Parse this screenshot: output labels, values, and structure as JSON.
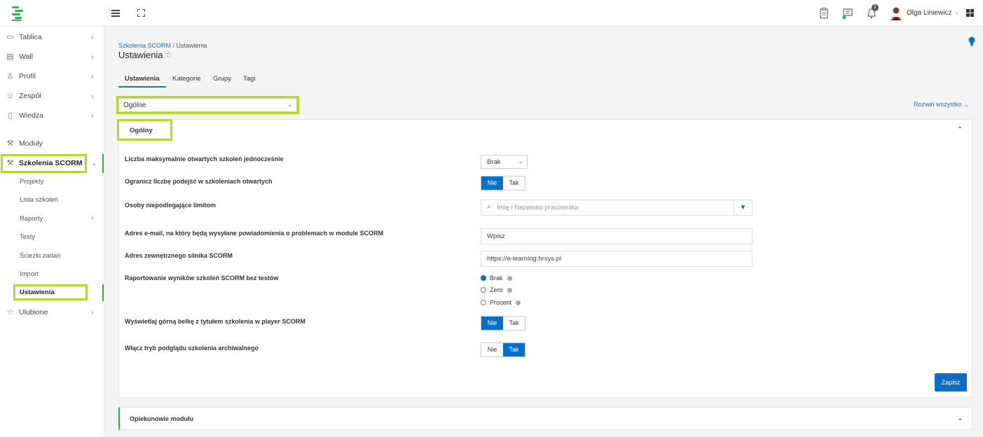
{
  "topbar": {
    "username": "Olga Liniewicz",
    "notification_count": "1"
  },
  "sidebar": {
    "items": [
      {
        "label": "Tablica"
      },
      {
        "label": "Wall"
      },
      {
        "label": "Profil"
      },
      {
        "label": "Zespół"
      },
      {
        "label": "Wiedza"
      },
      {
        "label": "Moduły"
      },
      {
        "label": "Szkolenia SCORM"
      },
      {
        "label": "Ulubione"
      }
    ],
    "subitems": [
      {
        "label": "Projekty"
      },
      {
        "label": "Lista szkoleń"
      },
      {
        "label": "Raporty"
      },
      {
        "label": "Testy"
      },
      {
        "label": "Ścieżki zadań"
      },
      {
        "label": "Import"
      },
      {
        "label": "Ustawienia"
      }
    ]
  },
  "breadcrumb": {
    "parent": "Szkolenia SCORM",
    "sep": " / ",
    "current": "Ustawienia"
  },
  "page": {
    "title": "Ustawienia"
  },
  "tabs": [
    {
      "label": "Ustawienia"
    },
    {
      "label": "Kategorie"
    },
    {
      "label": "Grupy"
    },
    {
      "label": "Tagi"
    }
  ],
  "section_select": {
    "value": "Ogólne"
  },
  "expand_all": "Rozwiń wszystko",
  "panel": {
    "title": "Ogólny",
    "rows": [
      {
        "label": "Liczba maksymalnie otwartych szkoleń jednocześnie",
        "value": "Brak"
      },
      {
        "label": "Ogranicz liczbę podejść w szkoleniach otwartych",
        "off": "Nie",
        "on": "Tak"
      },
      {
        "label": "Osoby niepodlegające limitom",
        "placeholder": "Imię i Nazwisko pracownika"
      },
      {
        "label": "Adres e-mail, na który będą wysyłane powiadomienia o problemach w module SCORM",
        "value": "Wpisz"
      },
      {
        "label": "Adres zewnętrznego silnika SCORM",
        "value": "https://e-learning.hrsys.pl"
      },
      {
        "label": "Raportowanie wyników szkoleń SCORM bez testów",
        "options": [
          "Brak",
          "Zero",
          "Procent"
        ],
        "selected": "Brak"
      },
      {
        "label": "Wyświetlaj górną belkę z tytułem szkolenia w player SCORM",
        "off": "Nie",
        "on": "Tak"
      },
      {
        "label": "Włącz tryb podglądu szkolenia archiwalnego",
        "off": "Nie",
        "on": "Tak"
      }
    ],
    "save_label": "Zapisz"
  },
  "panel2": {
    "title": "Opiekunowie modułu"
  },
  "colors": {
    "accent": "#0b6fc6",
    "brand": "#2db34a",
    "highlight": "#b5d92b"
  }
}
